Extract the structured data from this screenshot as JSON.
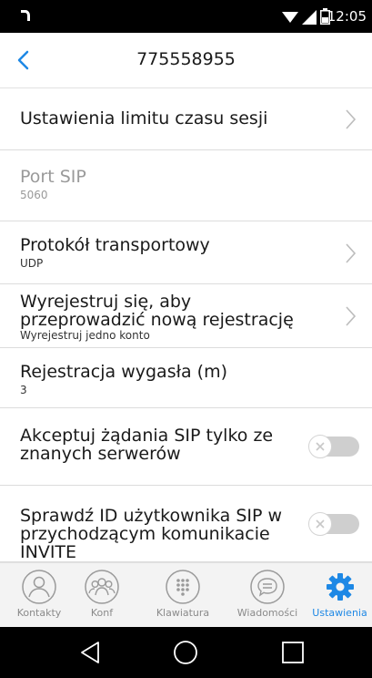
{
  "status": {
    "time": "12:05"
  },
  "header": {
    "title": "775558955"
  },
  "settings": [
    {
      "label": "Ustawienia limitu czasu sesji"
    },
    {
      "label": "Port SIP",
      "sub": "5060"
    },
    {
      "label": "Protokół transportowy",
      "sub": "UDP"
    },
    {
      "label": "Wyrejestruj się, aby przeprowadzić nową rejestrację",
      "sub": "Wyrejestruj jedno konto"
    },
    {
      "label": "Rejestracja wygasła (m)",
      "sub": "3"
    },
    {
      "label": "Akceptuj żądania SIP tylko ze znanych serwerów",
      "enabled": false
    },
    {
      "label": "Sprawdź ID użytkownika SIP w przychodzącym komunikacie INVITE",
      "enabled": false
    }
  ],
  "tabs": [
    {
      "label": "Kontakty",
      "icon": "contact-icon"
    },
    {
      "label": "Konf",
      "icon": "conference-icon"
    },
    {
      "label": "Klawiatura",
      "icon": "keypad-icon"
    },
    {
      "label": "Wiadomości",
      "icon": "message-icon"
    },
    {
      "label": "Ustawienia",
      "icon": "gear-icon",
      "active": true
    }
  ],
  "colors": {
    "accent": "#1e88e5",
    "toggle_off": "#cfcfcf",
    "statusbar": "#000000"
  }
}
